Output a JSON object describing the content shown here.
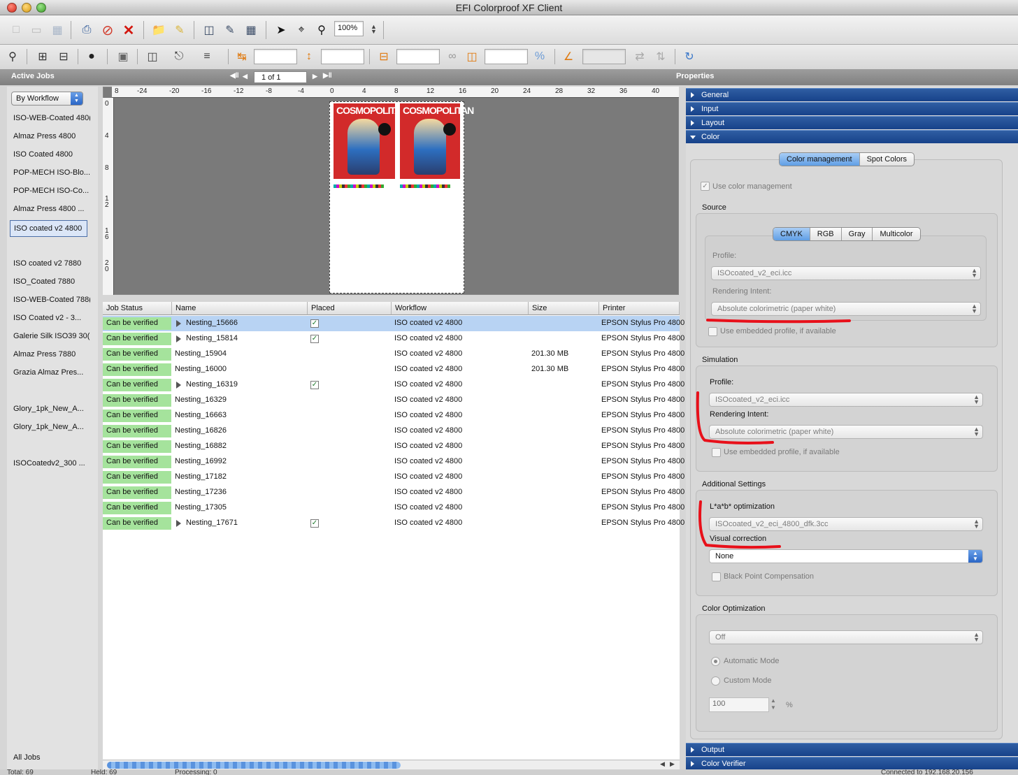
{
  "window": {
    "title": "EFI Colorproof XF Client"
  },
  "toolbar1": {
    "zoom_value": "100%",
    "icons": [
      "new-doc-icon",
      "new-doc2-icon",
      "save-icon",
      "print-icon",
      "stop-icon",
      "delete-icon",
      "folder-icon",
      "tag-icon",
      "preview-icon",
      "edit-icon",
      "table-icon",
      "arrow-tool-icon",
      "crop-tool-icon",
      "zoom-tool-icon"
    ]
  },
  "sectionbar": {
    "left_label": "Active Jobs",
    "page_field": "1 of 1",
    "right_label": "Properties"
  },
  "sidebar": {
    "filter": "By Workflow",
    "items": [
      "ISO-WEB-Coated 480(",
      "Almaz Press 4800",
      "ISO Coated 4800",
      "POP-MECH ISO-Blo...",
      "POP-MECH ISO-Co...",
      "Almaz Press 4800 ...",
      "ISO coated v2 4800",
      "ISO coated v2 7880",
      "ISO_Coated 7880",
      "ISO-WEB-Coated 788(",
      "ISO Coated v2 - 3...",
      "Galerie Silk ISO39 30(",
      "Almaz Press 7880",
      "Grazia Almaz Pres...",
      "Glory_1pk_New_A...",
      "Glory_1pk_New_A...",
      "ISOCoatedv2_300 ..."
    ],
    "footer": "All Jobs"
  },
  "ruler": {
    "top": [
      "8",
      "-24",
      "-20",
      "-16",
      "-12",
      "-8",
      "-4",
      "0",
      "4",
      "8",
      "12",
      "16",
      "20",
      "24",
      "28",
      "32",
      "36",
      "40"
    ],
    "left": [
      "0",
      "4",
      "8",
      "1\n2",
      "1\n6",
      "2\n0"
    ]
  },
  "table": {
    "columns": [
      "Job Status",
      "Name",
      "Placed",
      "Workflow",
      "Size",
      "Printer"
    ],
    "rows": [
      {
        "status": "Can be verified",
        "name": "Nesting_15666",
        "expand": true,
        "placed": true,
        "workflow": "ISO coated v2 4800",
        "size": "",
        "printer": "EPSON Stylus Pro 4800",
        "selected": true
      },
      {
        "status": "Can be verified",
        "name": "Nesting_15814",
        "expand": true,
        "placed": true,
        "workflow": "ISO coated v2 4800",
        "size": "",
        "printer": "EPSON Stylus Pro 4800"
      },
      {
        "status": "Can be verified",
        "name": "Nesting_15904",
        "expand": false,
        "placed": false,
        "workflow": "ISO coated v2 4800",
        "size": "201.30 MB",
        "printer": "EPSON Stylus Pro 4800"
      },
      {
        "status": "Can be verified",
        "name": "Nesting_16000",
        "expand": false,
        "placed": false,
        "workflow": "ISO coated v2 4800",
        "size": "201.30 MB",
        "printer": "EPSON Stylus Pro 4800"
      },
      {
        "status": "Can be verified",
        "name": "Nesting_16319",
        "expand": true,
        "placed": true,
        "workflow": "ISO coated v2 4800",
        "size": "",
        "printer": "EPSON Stylus Pro 4800"
      },
      {
        "status": "Can be verified",
        "name": "Nesting_16329",
        "expand": false,
        "placed": false,
        "workflow": "ISO coated v2 4800",
        "size": "",
        "printer": "EPSON Stylus Pro 4800"
      },
      {
        "status": "Can be verified",
        "name": "Nesting_16663",
        "expand": false,
        "placed": false,
        "workflow": "ISO coated v2 4800",
        "size": "",
        "printer": "EPSON Stylus Pro 4800"
      },
      {
        "status": "Can be verified",
        "name": "Nesting_16826",
        "expand": false,
        "placed": false,
        "workflow": "ISO coated v2 4800",
        "size": "",
        "printer": "EPSON Stylus Pro 4800"
      },
      {
        "status": "Can be verified",
        "name": "Nesting_16882",
        "expand": false,
        "placed": false,
        "workflow": "ISO coated v2 4800",
        "size": "",
        "printer": "EPSON Stylus Pro 4800"
      },
      {
        "status": "Can be verified",
        "name": "Nesting_16992",
        "expand": false,
        "placed": false,
        "workflow": "ISO coated v2 4800",
        "size": "",
        "printer": "EPSON Stylus Pro 4800"
      },
      {
        "status": "Can be verified",
        "name": "Nesting_17182",
        "expand": false,
        "placed": false,
        "workflow": "ISO coated v2 4800",
        "size": "",
        "printer": "EPSON Stylus Pro 4800"
      },
      {
        "status": "Can be verified",
        "name": "Nesting_17236",
        "expand": false,
        "placed": false,
        "workflow": "ISO coated v2 4800",
        "size": "",
        "printer": "EPSON Stylus Pro 4800"
      },
      {
        "status": "Can be verified",
        "name": "Nesting_17305",
        "expand": false,
        "placed": false,
        "workflow": "ISO coated v2 4800",
        "size": "",
        "printer": "EPSON Stylus Pro 4800"
      },
      {
        "status": "Can be verified",
        "name": "Nesting_17671",
        "expand": true,
        "placed": true,
        "workflow": "ISO coated v2 4800",
        "size": "",
        "printer": "EPSON Stylus Pro 4800"
      }
    ]
  },
  "props": {
    "sections": {
      "general": "General",
      "input": "Input",
      "layout": "Layout",
      "color": "Color",
      "output": "Output",
      "verifier": "Color Verifier"
    },
    "color_tabs": [
      "Color management",
      "Spot Colors"
    ],
    "use_cm": "Use color management",
    "source": {
      "label": "Source",
      "tabs": [
        "CMYK",
        "RGB",
        "Gray",
        "Multicolor"
      ],
      "profile_label": "Profile:",
      "profile": "ISOcoated_v2_eci.icc",
      "intent_label": "Rendering Intent:",
      "intent": "Absolute colorimetric (paper white)",
      "embedded": "Use embedded profile, if available"
    },
    "simulation": {
      "label": "Simulation",
      "profile_label": "Profile:",
      "profile": "ISOcoated_v2_eci.icc",
      "intent_label": "Rendering Intent:",
      "intent": "Absolute colorimetric (paper white)",
      "embedded": "Use embedded profile, if available"
    },
    "additional": {
      "label": "Additional Settings",
      "lab_label": "L*a*b* optimization",
      "lab": "ISOcoated_v2_eci_4800_dfk.3cc",
      "visual_label": "Visual correction",
      "visual": "None",
      "bpc": "Black Point Compensation"
    },
    "optimization": {
      "label": "Color Optimization",
      "mode_value": "Off",
      "auto": "Automatic Mode",
      "custom": "Custom Mode",
      "percent_value": "100",
      "percent_unit": "%"
    }
  },
  "statusbar": {
    "total": "Total: 69",
    "held": "Held: 69",
    "processing": "Processing: 0",
    "connected": "Connected to 192.168.20.156"
  },
  "colors": {
    "accent_blue": "#17428a",
    "status_green": "#a5e39c",
    "selection": "#b8d3f3",
    "annotation_red": "#e8101a"
  }
}
